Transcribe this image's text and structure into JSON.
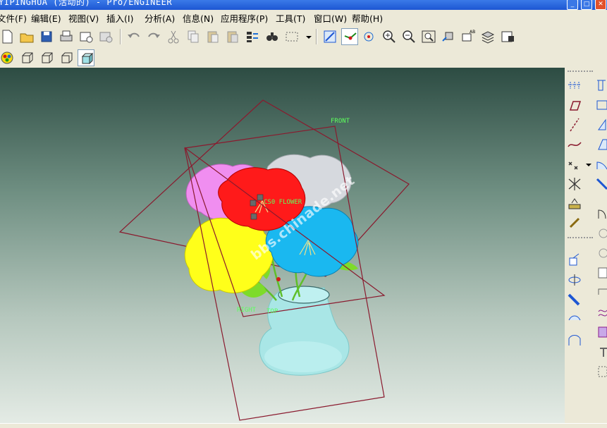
{
  "window": {
    "title": "YIPINGHUA (活动的) - Pro/ENGINEER"
  },
  "menu": [
    {
      "label": "文件(F)"
    },
    {
      "label": "编辑(E)"
    },
    {
      "label": "视图(V)"
    },
    {
      "label": "插入(I)"
    },
    {
      "label": "分析(A)"
    },
    {
      "label": "信息(N)"
    },
    {
      "label": "应用程序(P)"
    },
    {
      "label": "工具(T)"
    },
    {
      "label": "窗口(W)"
    },
    {
      "label": "帮助(H)"
    }
  ],
  "viewport": {
    "datum_labels": {
      "front": "FRONT",
      "top": "TOP",
      "right": "RIGHT",
      "csys": "CS0 FLOWER"
    },
    "watermark": "bbs.chinade.net"
  },
  "colors": {
    "datum_plane": "#8a1a2e",
    "datum_text": "#5dff5d",
    "flower_pink": "#f08ef0",
    "flower_red": "#ff1a1a",
    "flower_gray": "#d6d9de",
    "flower_yellow": "#ffff1a",
    "flower_blue": "#1ab8f0",
    "vase": "#a9e6e6",
    "leaves": "#7edb2a"
  }
}
